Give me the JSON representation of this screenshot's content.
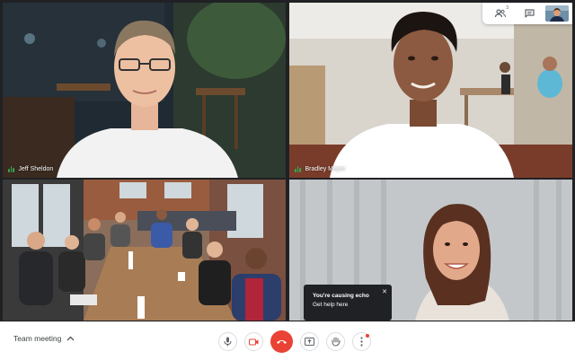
{
  "participants": [
    {
      "name": "Jeff Sheldon"
    },
    {
      "name": "Bradley Meyer"
    }
  ],
  "top_bar": {
    "people_count": "3",
    "people_icon": "people-icon",
    "chat_icon": "chat-icon"
  },
  "toast": {
    "title": "You're causing echo",
    "link": "Get help here",
    "close": "✕"
  },
  "bottom_bar": {
    "meeting_title": "Team meeting",
    "controls": [
      "mic-icon",
      "camera-icon",
      "end-call-icon",
      "present-screen-icon",
      "raise-hand-icon",
      "more-options-icon"
    ]
  },
  "colors": {
    "accent_green": "#34a853",
    "end_call_red": "#ea4335",
    "toast_bg": "#202124"
  }
}
